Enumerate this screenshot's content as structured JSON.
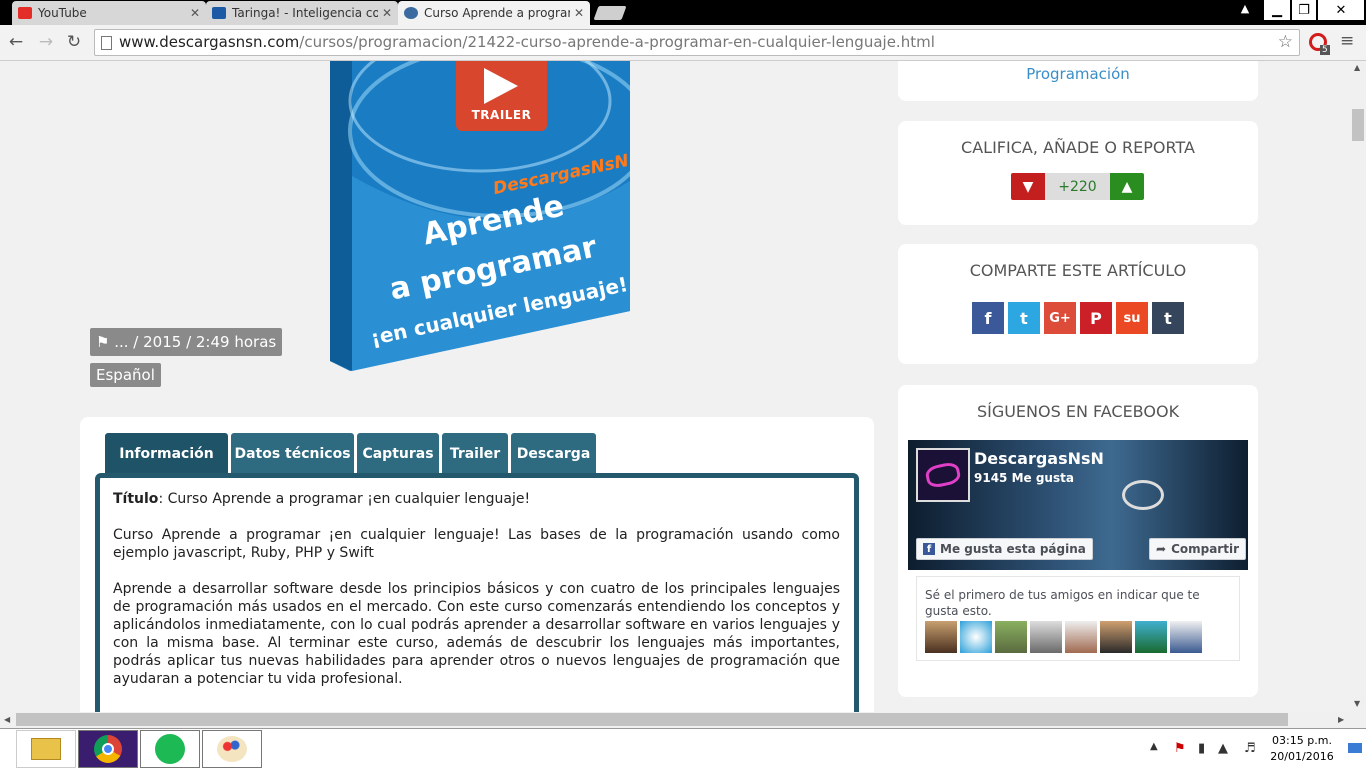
{
  "browser": {
    "tabs": [
      {
        "title": "YouTube",
        "close": "✕"
      },
      {
        "title": "Taringa! - Inteligencia cole",
        "close": "✕"
      },
      {
        "title": "Curso Aprende a program",
        "close": "✕"
      }
    ],
    "window_controls": {
      "minimize": "▁",
      "restore": "❐",
      "close": "✕"
    },
    "url_host": "www.descargasnsn.com",
    "url_path": "/cursos/programacion/21422-curso-aprende-a-programar-en-cualquier-lenguaje.html",
    "extension_badge": "5"
  },
  "product": {
    "cover": {
      "brand": "DescargasNsN",
      "line1": "Aprende",
      "line2": "a programar",
      "line3": "¡en cualquier lenguaje!"
    },
    "trailer_label": "TRAILER",
    "meta": "... / 2015 / 2:49 horas",
    "language": "Español"
  },
  "info": {
    "tabs": [
      "Información",
      "Datos técnicos",
      "Capturas",
      "Trailer",
      "Descarga"
    ],
    "title_label": "Título",
    "title_value": ": Curso Aprende a programar ¡en cualquier lenguaje!",
    "paragraph1": "Curso Aprende a programar ¡en cualquier lenguaje! Las bases de la programación usando como ejemplo javascript, Ruby, PHP y Swift",
    "paragraph2": "Aprende a desarrollar software desde los principios básicos y con cuatro de los principales lenguajes de programación más usados en el mercado. Con este curso comenzarás entendiendo los conceptos y aplicándolos inmediatamente, con lo cual podrás aprender a desarrollar software en varios lenguajes y con la misma base. Al terminar este curso, además de descubrir los lenguajes más importantes, podrás aplicar tus nuevas habilidades para aprender otros o nuevos lenguajes de programación que ayudaran a potenciar tu vida profesional."
  },
  "sidebar": {
    "category_link": "Programación",
    "rate_title": "CALIFICA, AÑADE O REPORTA",
    "rate_count": "+220",
    "share_title": "COMPARTE ESTE ARTÍCULO",
    "share_buttons": [
      {
        "label": "f",
        "color": "#3b5998"
      },
      {
        "label": "t",
        "color": "#2da7e1"
      },
      {
        "label": "G+",
        "color": "#dd4b39"
      },
      {
        "label": "P",
        "color": "#cb2027"
      },
      {
        "label": "su",
        "color": "#eb4924"
      },
      {
        "label": "t",
        "color": "#35465c"
      }
    ],
    "facebook_title": "SÍGUENOS EN FACEBOOK",
    "fb_page_name": "DescargasNsN",
    "fb_likes": "9145 Me gusta",
    "fb_like_button": "Me gusta esta página",
    "fb_share_button": "Compartir",
    "fb_friends_text": "Sé el primero de tus amigos en indicar que te gusta esto."
  },
  "taskbar": {
    "time": "03:15 p.m.",
    "date": "20/01/2016"
  },
  "colors": {
    "tab_blue": "#2e6a80",
    "link_blue": "#3a8ec8",
    "trailer_red": "#d8462d"
  }
}
